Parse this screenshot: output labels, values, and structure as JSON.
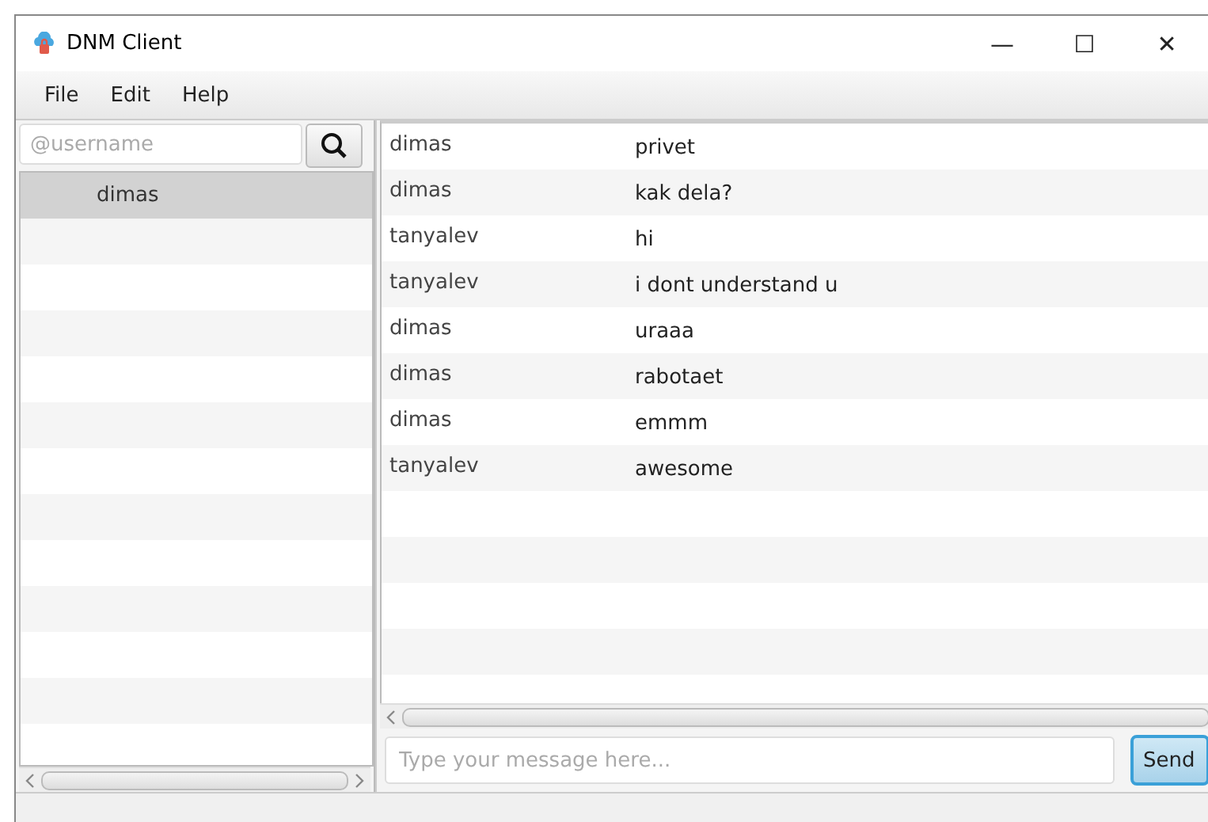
{
  "window": {
    "title": "DNM Client",
    "controls": [
      "—",
      "☐",
      "✕"
    ]
  },
  "menu": [
    {
      "label": "File"
    },
    {
      "label": "Edit"
    },
    {
      "label": "Help"
    }
  ],
  "search": {
    "placeholder": "@username"
  },
  "contacts": [
    {
      "name": "dimas",
      "selected": true
    }
  ],
  "messages": [
    {
      "user": "dimas",
      "text": "privet"
    },
    {
      "user": "dimas",
      "text": "kak dela?"
    },
    {
      "user": "tanyalev",
      "text": "hi"
    },
    {
      "user": "tanyalev",
      "text": "i dont understand u"
    },
    {
      "user": "dimas",
      "text": "uraaa"
    },
    {
      "user": "dimas",
      "text": "rabotaet"
    },
    {
      "user": "dimas",
      "text": "emmm"
    },
    {
      "user": "tanyalev",
      "text": "awesome"
    }
  ],
  "composer": {
    "placeholder": "Type your message here...",
    "button": "Send"
  }
}
